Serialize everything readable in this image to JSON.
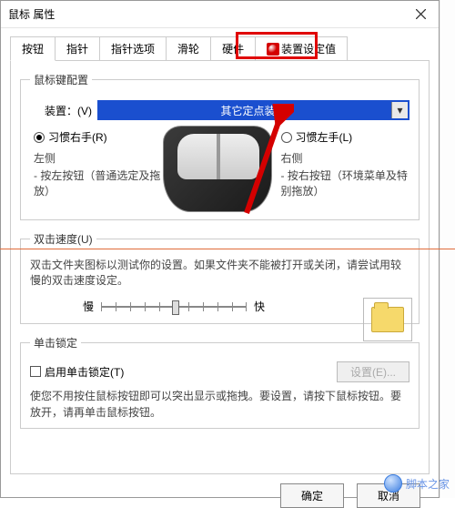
{
  "window": {
    "title": "鼠标 属性"
  },
  "tabs": [
    "按钮",
    "指针",
    "指针选项",
    "滑轮",
    "硬件",
    "装置设定值"
  ],
  "activeTabIndex": 0,
  "highlightTabIndex": 5,
  "groups": {
    "config": {
      "legend": "鼠标键配置",
      "deviceLabel": "装置：(V)",
      "deviceValue": "其它定点装置",
      "rightHand": "习惯右手(R)",
      "leftHand": "习惯左手(L)",
      "leftSide": "左侧",
      "leftSideDesc": "- 按左按钮（普通选定及拖放）",
      "rightSide": "右侧",
      "rightSideDesc": "- 按右按钮（环境菜单及特别拖放）"
    },
    "double": {
      "legend": "双击速度(U)",
      "desc": "双击文件夹图标以测试你的设置。如果文件夹不能被打开或关闭，请尝试用较慢的双击速度设定。",
      "slow": "慢",
      "fast": "快"
    },
    "lock": {
      "legend": "单击锁定",
      "enable": "启用单击锁定(T)",
      "settingsBtn": "设置(E)...",
      "desc": "使您不用按住鼠标按钮即可以突出显示或拖拽。要设置，请按下鼠标按钮。要放开，请再单击鼠标按钮。"
    }
  },
  "buttons": {
    "ok": "确定",
    "cancel": "取消"
  },
  "watermark": "脚本之家"
}
